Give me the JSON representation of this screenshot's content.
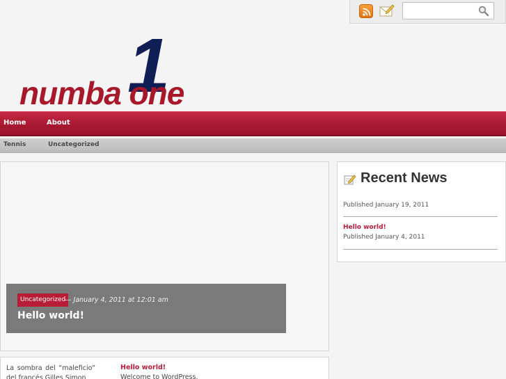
{
  "header": {
    "logo_numeral": "1",
    "logo_text": "numba one",
    "search_placeholder": ""
  },
  "nav": {
    "items": [
      "Home",
      "About"
    ]
  },
  "categories": {
    "items": [
      "Tennis",
      "Uncategorized"
    ]
  },
  "featured": {
    "category": "Uncategorized",
    "date": "— January 4, 2011 at 12:01 am",
    "title": "Hello world!"
  },
  "posts": {
    "left_excerpt": "La sombra del “maleficio” del francés Gilles Simon",
    "right_title": "Hello world!",
    "right_excerpt": "Welcome to WordPress."
  },
  "sidebar": {
    "title": "Recent News",
    "items": [
      {
        "title": "",
        "meta": "Published January 19, 2011"
      },
      {
        "title": "Hello world!",
        "meta": "Published January 4, 2011"
      }
    ]
  },
  "colors": {
    "accent": "#b81d37",
    "logo_dark": "#0f1e55"
  }
}
